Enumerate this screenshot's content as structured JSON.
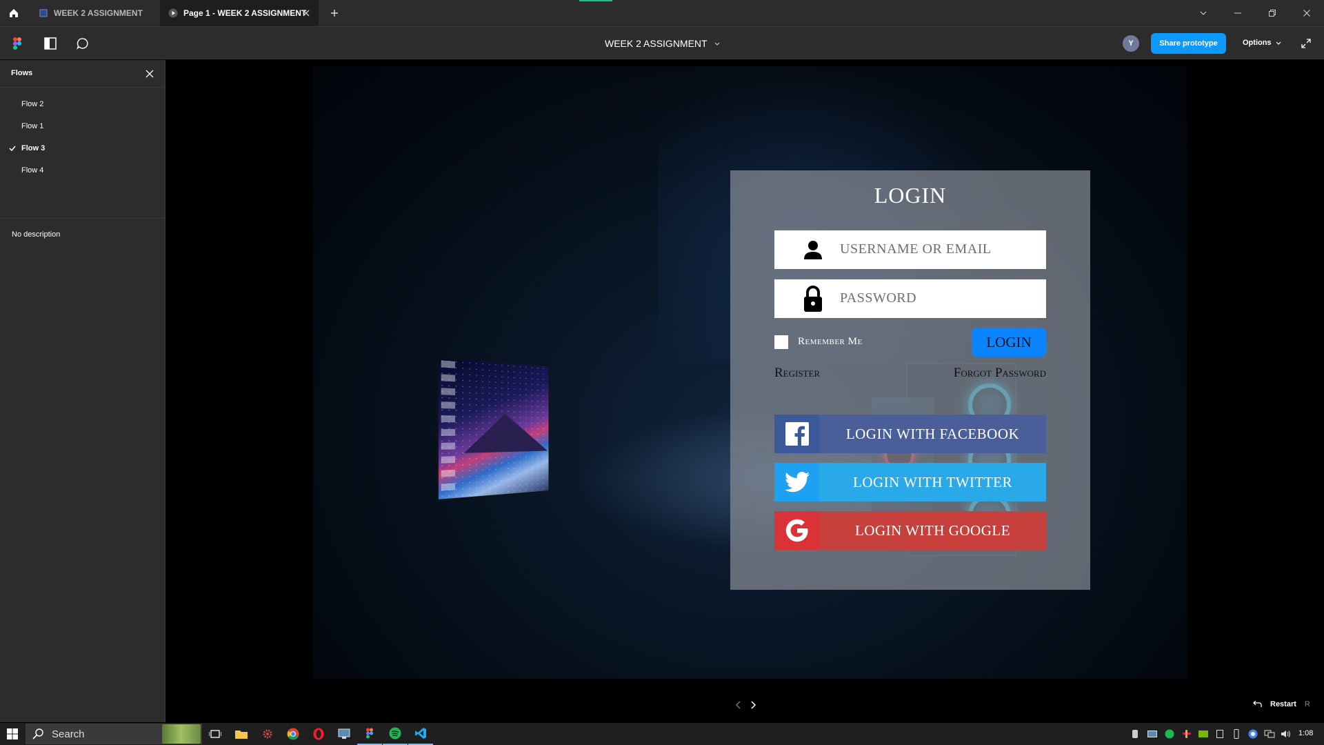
{
  "titlebar": {
    "tabs": [
      {
        "label": "WEEK 2 ASSIGNMENT"
      },
      {
        "label": "Page 1 - WEEK 2 ASSIGNMENT"
      }
    ]
  },
  "toolbar": {
    "file_title": "WEEK 2 ASSIGNMENT",
    "avatar_initial": "Y",
    "share_label": "Share prototype",
    "options_label": "Options"
  },
  "sidebar": {
    "title": "Flows",
    "flows": [
      {
        "label": "Flow 2",
        "active": false
      },
      {
        "label": "Flow 1",
        "active": false
      },
      {
        "label": "Flow 3",
        "active": true
      },
      {
        "label": "Flow 4",
        "active": false
      }
    ],
    "description": "No description"
  },
  "login": {
    "title": "LOGIN",
    "username_placeholder": "USERNAME OR EMAIL",
    "password_placeholder": "PASSWORD",
    "remember_label": "Remember Me",
    "login_button": "LOGIN",
    "register_label": "Register",
    "forgot_label": "Forgot Password",
    "facebook_label": "LOGIN WITH FACEBOOK",
    "twitter_label": "LOGIN WITH TWITTER",
    "google_label": "LOGIN WITH GOOGLE"
  },
  "prototype_nav": {
    "restart_label": "Restart",
    "restart_key": "R"
  },
  "taskbar": {
    "search_label": "Search",
    "clock": "1:08"
  },
  "colors": {
    "accent": "#0d99ff",
    "login_button": "#0a84ff",
    "facebook": "#3b5998",
    "twitter": "#1da1f2",
    "google": "#db3236"
  },
  "icons": [
    "home-icon",
    "figma-icon",
    "sidebar-toggle-icon",
    "comment-icon",
    "fullscreen-icon",
    "user-icon",
    "lock-icon",
    "facebook-icon",
    "twitter-icon",
    "google-icon",
    "windows-start-icon",
    "search-icon"
  ]
}
